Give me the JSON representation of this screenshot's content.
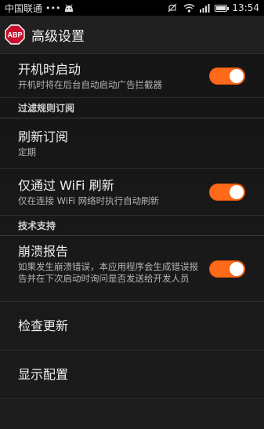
{
  "status_bar": {
    "carrier": "中国联通",
    "dots": "•••",
    "time": "13:54",
    "icons": [
      "android-icon",
      "mute-icon",
      "wifi-icon",
      "signal-icon",
      "battery-icon"
    ]
  },
  "action_bar": {
    "logo_text": "ABP",
    "title": "高级设置"
  },
  "preferences": {
    "autostart": {
      "title": "开机时启动",
      "summary": "开机时将在后台自动启动广告拦截器",
      "checked": true
    },
    "category_filters": "过滤规则订阅",
    "refresh": {
      "title": "刷新订阅",
      "summary": "定期"
    },
    "wifi_only": {
      "title": "仅通过 WiFi 刷新",
      "summary": "仅在连接 WiFi 网络时执行自动刷新",
      "checked": true
    },
    "category_support": "技术支持",
    "crash_report": {
      "title": "崩溃报告",
      "summary": "如果发生崩溃错误，本应用程序会生成错误报告并在下次启动时询问是否发送给开发人员",
      "checked": true
    },
    "check_updates": {
      "title": "检查更新"
    },
    "show_config": {
      "title": "显示配置"
    }
  },
  "colors": {
    "toggle_on": "#ff6a1a",
    "background": "#181818",
    "abp_red": "#c8102e"
  }
}
